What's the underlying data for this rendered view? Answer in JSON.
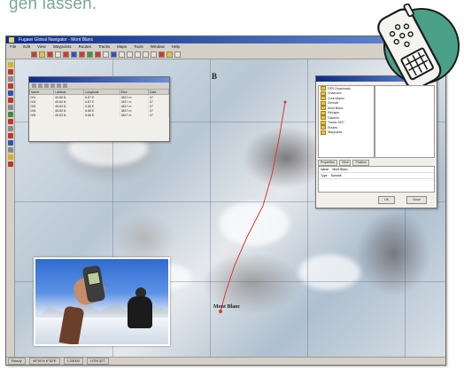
{
  "caption": "gen lassen.",
  "window": {
    "title": "Fugawi Global Navigator - Mont Blanc",
    "menu": [
      "File",
      "Edit",
      "View",
      "Waypoints",
      "Routes",
      "Tracks",
      "Maps",
      "Tools",
      "Window",
      "Help"
    ]
  },
  "map": {
    "labels": [
      "Mont Blanc"
    ]
  },
  "waypoints_panel": {
    "columns": [
      "Name",
      "Latitude",
      "Longitude",
      "Elev",
      "Date"
    ],
    "rows": [
      [
        "001",
        "45.85 N",
        "6.87 E",
        "3817 m",
        "07"
      ],
      [
        "002",
        "45.84 N",
        "6.87 E",
        "3817 m",
        "07"
      ],
      [
        "003",
        "45.84 N",
        "6.86 E",
        "3817 m",
        "07"
      ],
      [
        "004",
        "45.83 N",
        "6.86 E",
        "3817 m",
        "07"
      ],
      [
        "005",
        "45.83 N",
        "6.86 E",
        "3817 m",
        "07"
      ]
    ]
  },
  "tree_panel": {
    "items": [
      "GPS Downloads",
      "Chamonix",
      "Courmayeur",
      "Zermatt",
      "Mont Blanc",
      "Refuges",
      "Glaciers",
      "Tracks 2007",
      "Routes",
      "Waypoints"
    ],
    "tabs": [
      "Properties",
      "View",
      "Position"
    ],
    "prop_rows": [
      [
        "Name",
        "Mont Blanc"
      ],
      [
        "Type",
        "Summit"
      ]
    ],
    "ok_label": "OK",
    "close_label": "Close"
  },
  "statusbar": [
    "Ready",
    "45°50'N 6°52'E",
    "1:25000",
    "UTM 32T"
  ],
  "colors": {
    "caption": "#7aa79c",
    "badge_fill": "#4aa187",
    "route": "#d33c2c"
  },
  "icons": {
    "badge": "gps-device-icon"
  }
}
